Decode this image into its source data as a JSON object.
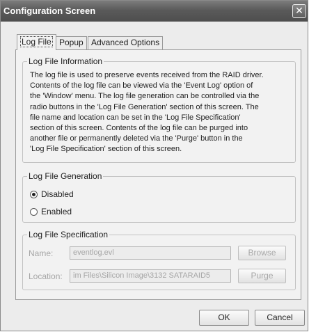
{
  "window": {
    "title": "Configuration Screen",
    "close_glyph": "✕"
  },
  "tabs": [
    "Log File",
    "Popup",
    "Advanced Options"
  ],
  "info": {
    "legend": "Log File Information",
    "lines": [
      "The log file is used to preserve events received from the RAID driver.",
      "Contents of the log file can be viewed via the 'Event Log' option of",
      "the 'Window' menu. The log file generation can be controlled via the",
      "radio buttons in the 'Log File Generation' section of this screen. The",
      "file name and location can be set in  the  'Log File Specification'",
      "section of this screen.  Contents of the log file can be purged into",
      "another file  or  permanently deleted via the 'Purge' button in the",
      "'Log File Specification' section of this screen."
    ]
  },
  "generation": {
    "legend": "Log File Generation",
    "disabled_label": "Disabled",
    "enabled_label": "Enabled",
    "selected": "Disabled"
  },
  "spec": {
    "legend": "Log File Specification",
    "name_label": "Name:",
    "name_value": "eventlog.evl",
    "location_label": "Location:",
    "location_value": "im Files\\Silicon Image\\3132 SATARAID5",
    "browse_label": "Browse",
    "purge_label": "Purge"
  },
  "footer": {
    "ok_label": "OK",
    "cancel_label": "Cancel"
  }
}
